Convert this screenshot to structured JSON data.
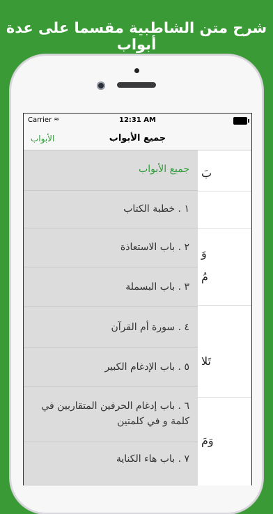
{
  "headline": "شرح متن الشاطبية مقسما على عدة أبواب",
  "status": {
    "carrier": "Carrier",
    "wifi": "wifi-icon",
    "time": "12:31 AM"
  },
  "nav": {
    "title": "جميع الأبواب",
    "left": "الأبواب"
  },
  "menu": [
    "جميع الأبواب",
    "١ . خطبة الكتاب",
    "٢ . باب الاستعاذة",
    "٣ . باب البسملة",
    "٤ . سورة أم القرآن",
    "٥ . باب الإدغام الكبير",
    "٦ . باب إدغام الحرفين المتقاربين في كلمة و في كلمتين",
    "٧ . باب هاء الكناية"
  ],
  "content_fragments": [
    "بَ",
    "وَ",
    "مُ",
    "تَلا",
    "وَمَ"
  ],
  "colors": {
    "accent": "#2f9a3a",
    "background": "#3a9a35"
  }
}
